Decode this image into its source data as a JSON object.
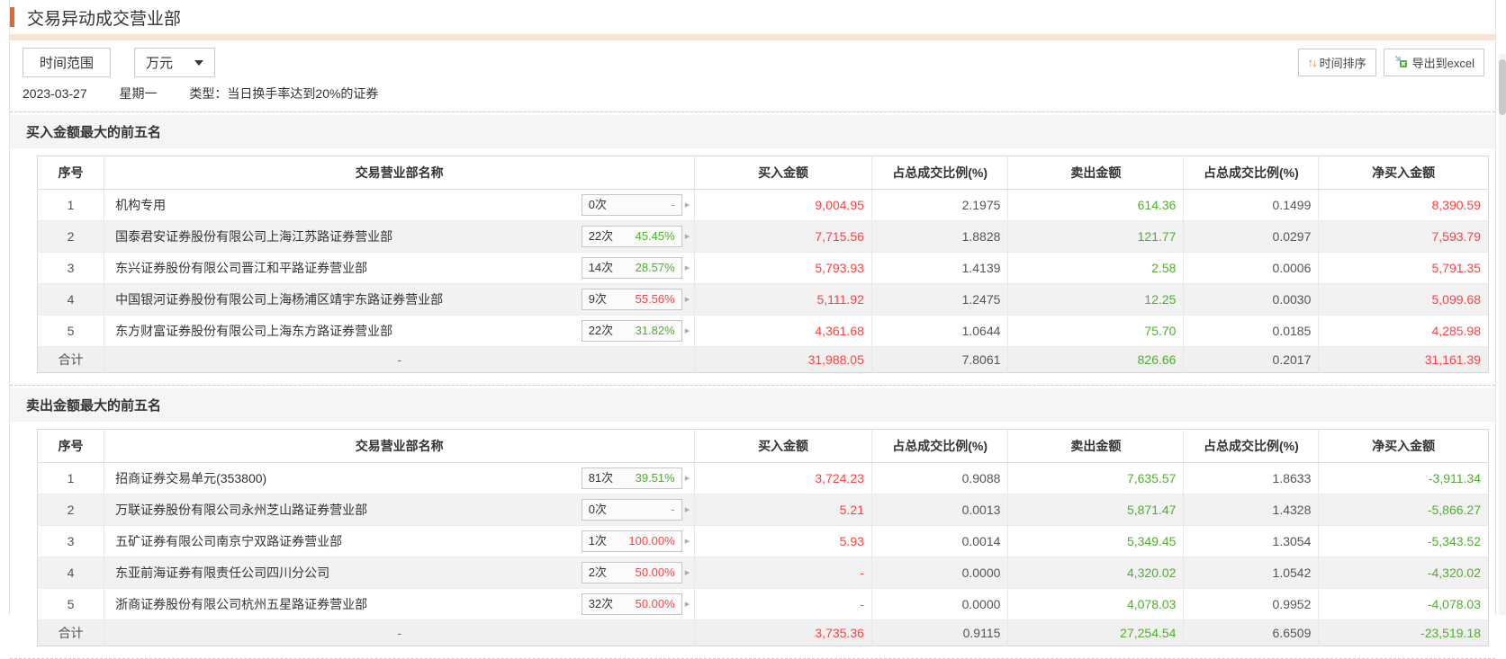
{
  "title": "交易异动成交营业部",
  "toolbar": {
    "time_range_label": "时间范围",
    "unit_value": "万元",
    "sort_label": "时间排序",
    "export_label": "导出到excel"
  },
  "info": {
    "date": "2023-03-27",
    "weekday": "星期一",
    "type_text": "类型：当日换手率达到20%的证券"
  },
  "colors": {
    "accent_orange": "#e8642a",
    "peach_strip": "#fbe3d4",
    "buy_red": "#fb4242",
    "sell_green": "#4fae2d",
    "section_bg": "#f5f5f5",
    "alt_row_bg": "#f2f2f2",
    "total_row_bg": "#f0f0f0"
  },
  "table_headers": [
    "序号",
    "交易营业部名称",
    "买入金额",
    "占总成交比例(%)",
    "卖出金额",
    "占总成交比例(%)",
    "净买入金额"
  ],
  "sections": [
    {
      "id": "buy-top5",
      "title": "买入金额最大的前五名",
      "rows": [
        {
          "seq": "1",
          "name": "机构专用",
          "times": "0次",
          "pct": "-",
          "pct_color": "dim",
          "buy": "9,004.95",
          "buy_color": "red",
          "buy_ratio": "2.1975",
          "sell": "614.36",
          "sell_color": "green",
          "sell_ratio": "0.1499",
          "net": "8,390.59",
          "net_color": "red"
        },
        {
          "seq": "2",
          "name": "国泰君安证券股份有限公司上海江苏路证券营业部",
          "times": "22次",
          "pct": "45.45%",
          "pct_color": "green",
          "buy": "7,715.56",
          "buy_color": "red",
          "buy_ratio": "1.8828",
          "sell": "121.77",
          "sell_color": "green",
          "sell_ratio": "0.0297",
          "net": "7,593.79",
          "net_color": "red"
        },
        {
          "seq": "3",
          "name": "东兴证券股份有限公司晋江和平路证券营业部",
          "times": "14次",
          "pct": "28.57%",
          "pct_color": "green",
          "buy": "5,793.93",
          "buy_color": "red",
          "buy_ratio": "1.4139",
          "sell": "2.58",
          "sell_color": "green",
          "sell_ratio": "0.0006",
          "net": "5,791.35",
          "net_color": "red"
        },
        {
          "seq": "4",
          "name": "中国银河证券股份有限公司上海杨浦区靖宇东路证券营业部",
          "times": "9次",
          "pct": "55.56%",
          "pct_color": "red",
          "buy": "5,111.92",
          "buy_color": "red",
          "buy_ratio": "1.2475",
          "sell": "12.25",
          "sell_color": "green",
          "sell_ratio": "0.0030",
          "net": "5,099.68",
          "net_color": "red"
        },
        {
          "seq": "5",
          "name": "东方财富证券股份有限公司上海东方路证券营业部",
          "times": "22次",
          "pct": "31.82%",
          "pct_color": "green",
          "buy": "4,361.68",
          "buy_color": "red",
          "buy_ratio": "1.0644",
          "sell": "75.70",
          "sell_color": "green",
          "sell_ratio": "0.0185",
          "net": "4,285.98",
          "net_color": "red"
        }
      ],
      "total": {
        "seq": "合计",
        "name": "-",
        "buy": "31,988.05",
        "buy_color": "red",
        "buy_ratio": "7.8061",
        "sell": "826.66",
        "sell_color": "green",
        "sell_ratio": "0.2017",
        "net": "31,161.39",
        "net_color": "red"
      }
    },
    {
      "id": "sell-top5",
      "title": "卖出金额最大的前五名",
      "rows": [
        {
          "seq": "1",
          "name": "招商证券交易单元(353800)",
          "times": "81次",
          "pct": "39.51%",
          "pct_color": "green",
          "buy": "3,724.23",
          "buy_color": "red",
          "buy_ratio": "0.9088",
          "sell": "7,635.57",
          "sell_color": "green",
          "sell_ratio": "1.8633",
          "net": "-3,911.34",
          "net_color": "green"
        },
        {
          "seq": "2",
          "name": "万联证券股份有限公司永州芝山路证券营业部",
          "times": "0次",
          "pct": "-",
          "pct_color": "dim",
          "buy": "5.21",
          "buy_color": "red",
          "buy_ratio": "0.0013",
          "sell": "5,871.47",
          "sell_color": "green",
          "sell_ratio": "1.4328",
          "net": "-5,866.27",
          "net_color": "green"
        },
        {
          "seq": "3",
          "name": "五矿证券有限公司南京宁双路证券营业部",
          "times": "1次",
          "pct": "100.00%",
          "pct_color": "red",
          "buy": "5.93",
          "buy_color": "red",
          "buy_ratio": "0.0014",
          "sell": "5,349.45",
          "sell_color": "green",
          "sell_ratio": "1.3054",
          "net": "-5,343.52",
          "net_color": "green"
        },
        {
          "seq": "4",
          "name": "东亚前海证券有限责任公司四川分公司",
          "times": "2次",
          "pct": "50.00%",
          "pct_color": "red",
          "buy": "-",
          "buy_color": "red",
          "buy_ratio": "0.0000",
          "sell": "4,320.02",
          "sell_color": "green",
          "sell_ratio": "1.0542",
          "net": "-4,320.02",
          "net_color": "green"
        },
        {
          "seq": "5",
          "name": "浙商证券股份有限公司杭州五星路证券营业部",
          "times": "32次",
          "pct": "50.00%",
          "pct_color": "red",
          "buy": "-",
          "buy_color": "red",
          "buy_ratio": "0.0000",
          "sell": "4,078.03",
          "sell_color": "green",
          "sell_ratio": "0.9952",
          "net": "-4,078.03",
          "net_color": "green"
        }
      ],
      "total": {
        "seq": "合计",
        "name": "-",
        "buy": "3,735.36",
        "buy_color": "red",
        "buy_ratio": "0.9115",
        "sell": "27,254.54",
        "sell_color": "green",
        "sell_ratio": "6.6509",
        "net": "-23,519.18",
        "net_color": "green"
      }
    }
  ]
}
